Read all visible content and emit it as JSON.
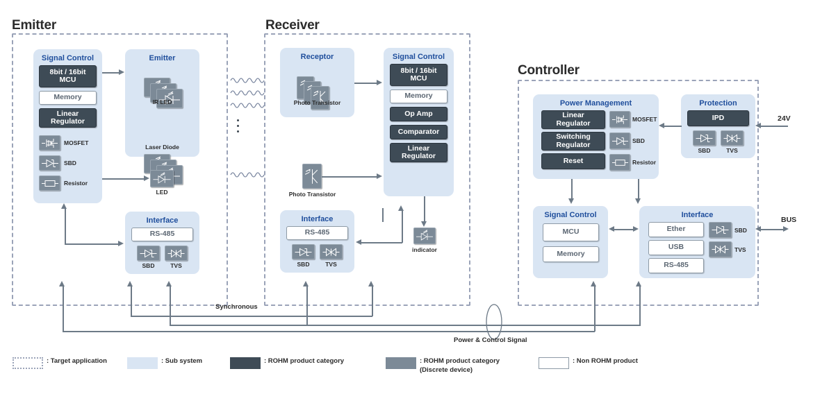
{
  "diagram": {
    "sections": {
      "emitter": {
        "title": "Emitter"
      },
      "receiver": {
        "title": "Receiver"
      },
      "controller": {
        "title": "Controller"
      }
    },
    "emitter": {
      "signal_control": {
        "title": "Signal Control",
        "blocks": [
          {
            "label": "8bit / 16bit\nMCU",
            "kind": "rohm"
          },
          {
            "label": "Memory",
            "kind": "nonrohm"
          },
          {
            "label": "Linear\nRegulator",
            "kind": "rohm"
          }
        ],
        "discretes": [
          {
            "label": "MOSFET",
            "icon": "mosfet-icon"
          },
          {
            "label": "SBD",
            "icon": "sbd-icon"
          },
          {
            "label": "Resistor",
            "icon": "resistor-icon"
          }
        ]
      },
      "emitter_block": {
        "title": "Emitter",
        "devices": [
          {
            "label": "IR LED",
            "icon": "led-icon"
          },
          {
            "label": "Laser Diode",
            "icon": "laser-diode-icon"
          }
        ]
      },
      "led": {
        "label": "LED",
        "icon": "led-icon"
      },
      "interface": {
        "title": "Interface",
        "blocks": [
          {
            "label": "RS-485",
            "kind": "nonrohm"
          }
        ],
        "discretes": [
          {
            "label": "SBD",
            "icon": "sbd-icon"
          },
          {
            "label": "TVS",
            "icon": "tvs-icon"
          }
        ]
      }
    },
    "receiver": {
      "receptor": {
        "title": "Receptor",
        "devices": [
          {
            "label": "Photo Transistor",
            "icon": "photo-transistor-icon"
          }
        ]
      },
      "photo_transistor": {
        "label": "Photo Transistor",
        "icon": "photo-transistor-icon"
      },
      "signal_control": {
        "title": "Signal Control",
        "blocks": [
          {
            "label": "8bit / 16bit\nMCU",
            "kind": "rohm"
          },
          {
            "label": "Memory",
            "kind": "nonrohm"
          },
          {
            "label": "Op Amp",
            "kind": "rohm"
          },
          {
            "label": "Comparator",
            "kind": "rohm"
          },
          {
            "label": "Linear\nRegulator",
            "kind": "rohm"
          }
        ]
      },
      "interface": {
        "title": "Interface",
        "blocks": [
          {
            "label": "RS-485",
            "kind": "nonrohm"
          }
        ],
        "discretes": [
          {
            "label": "SBD",
            "icon": "sbd-icon"
          },
          {
            "label": "TVS",
            "icon": "tvs-icon"
          }
        ]
      },
      "indicator": {
        "label": "indicator",
        "icon": "led-icon"
      }
    },
    "controller": {
      "power_management": {
        "title": "Power Management",
        "blocks": [
          {
            "label": "Linear\nRegulator",
            "kind": "rohm"
          },
          {
            "label": "Switching\nRegulator",
            "kind": "rohm"
          },
          {
            "label": "Reset",
            "kind": "rohm"
          }
        ],
        "discretes": [
          {
            "label": "MOSFET",
            "icon": "mosfet-icon"
          },
          {
            "label": "SBD",
            "icon": "sbd-icon"
          },
          {
            "label": "Resistor",
            "icon": "resistor-icon"
          }
        ]
      },
      "protection": {
        "title": "Protection",
        "blocks": [
          {
            "label": "IPD",
            "kind": "rohm"
          }
        ],
        "discretes": [
          {
            "label": "SBD",
            "icon": "sbd-icon"
          },
          {
            "label": "TVS",
            "icon": "tvs-icon"
          }
        ]
      },
      "signal_control": {
        "title": "Signal Control",
        "blocks": [
          {
            "label": "MCU",
            "kind": "nonrohm"
          },
          {
            "label": "Memory",
            "kind": "nonrohm"
          }
        ]
      },
      "interface": {
        "title": "Interface",
        "blocks": [
          {
            "label": "Ether",
            "kind": "nonrohm"
          },
          {
            "label": "USB",
            "kind": "nonrohm"
          },
          {
            "label": "RS-485",
            "kind": "nonrohm"
          }
        ],
        "discretes": [
          {
            "label": "SBD",
            "icon": "sbd-icon"
          },
          {
            "label": "TVS",
            "icon": "tvs-icon"
          }
        ]
      }
    },
    "io": {
      "supply": "24V",
      "bus": "BUS"
    },
    "wires": {
      "synchronous": "Synchronous",
      "power_control": "Power & Control Signal"
    },
    "legend": [
      {
        "swatch": "target",
        "text": ": Target application"
      },
      {
        "swatch": "sub",
        "text": ": Sub system"
      },
      {
        "swatch": "rohm",
        "text": ": ROHM product category"
      },
      {
        "swatch": "disc",
        "text": ": ROHM product category\n(Discrete device)"
      },
      {
        "swatch": "non",
        "text": ": Non ROHM product"
      }
    ],
    "colors": {
      "subsystem": "#d9e5f3",
      "rohm": "#3e4b56",
      "discrete": "#7c8a97",
      "dashed_border": "#9aa3b8",
      "wire": "#6d7a87",
      "title_blue": "#1f4e9c"
    }
  }
}
